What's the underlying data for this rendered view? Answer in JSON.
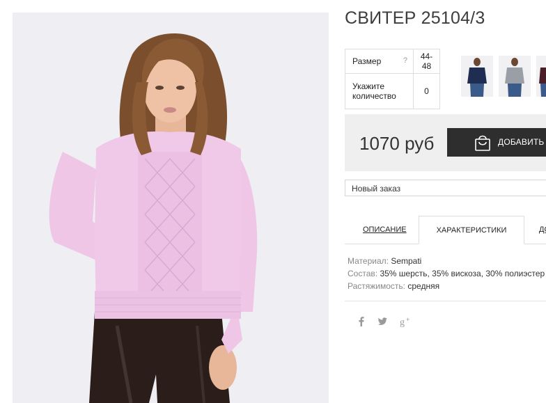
{
  "product": {
    "title": "СВИТЕР 25104/3"
  },
  "size_table": {
    "size_label": "Размер",
    "size_help": "?",
    "size_value": "44-48",
    "qty_label": "Укажите количество",
    "qty_value": "0"
  },
  "thumbnails": [
    {
      "name": "navy-sweater"
    },
    {
      "name": "gray-sweater"
    },
    {
      "name": "dark-sweater"
    }
  ],
  "buy": {
    "price": "1070 руб",
    "cart_button": "ДОБАВИТЬ В КОРЗИНУ"
  },
  "order_select": {
    "value": "Новый заказ"
  },
  "tabs": {
    "description": "ОПИСАНИЕ",
    "characteristics": "ХАРАКТЕРИСТИКИ",
    "third": "ДОСТАВКА"
  },
  "specs": [
    {
      "key": "Материал:",
      "value": "Sempati"
    },
    {
      "key": "Состав:",
      "value": "35% шерсть, 35% вискоза, 30% полиэстер"
    },
    {
      "key": "Растяжимость:",
      "value": "средняя"
    }
  ],
  "colors": {
    "sweater": "#f0c8e8",
    "leggings": "#2b1e1a",
    "hair": "#8a5a35",
    "button": "#2e2e2e"
  }
}
